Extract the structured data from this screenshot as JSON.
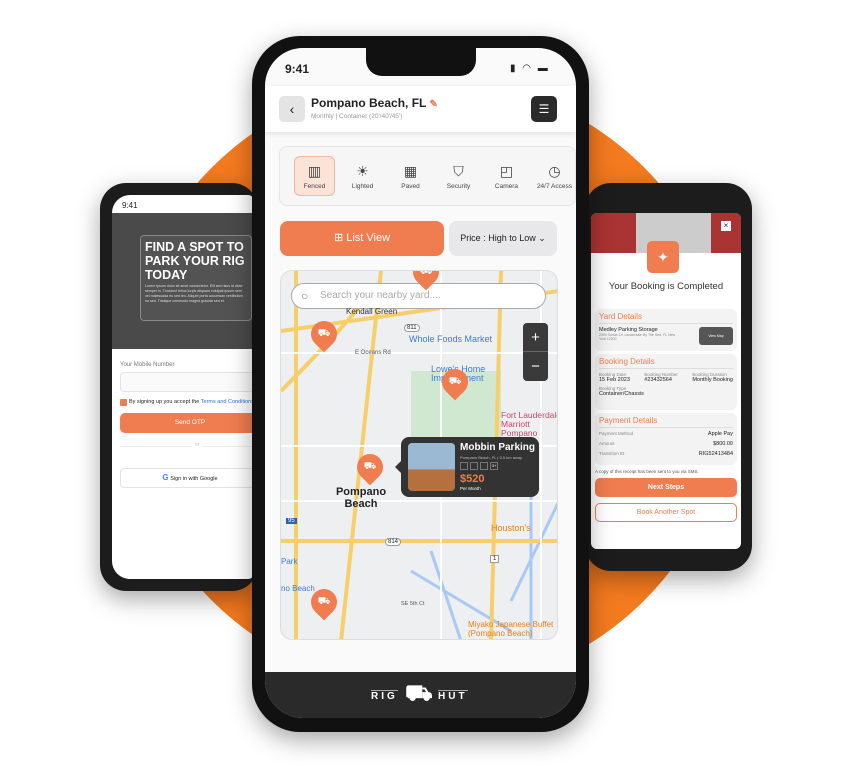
{
  "colors": {
    "accent": "#ef7d4f",
    "background_circle": "#f47a1f"
  },
  "main": {
    "status_time": "9:41",
    "header": {
      "title": "Pompano Beach, FL",
      "subtitle": "Monthly | Container (20'/40'/45')"
    },
    "amenities": [
      {
        "label": "Fenced",
        "icon": "fence-icon",
        "selected": true
      },
      {
        "label": "Lighted",
        "icon": "lightbulb-icon"
      },
      {
        "label": "Paved",
        "icon": "paved-icon"
      },
      {
        "label": "Security",
        "icon": "shield-check-icon"
      },
      {
        "label": "Camera",
        "icon": "cctv-camera-icon"
      },
      {
        "label": "24/7 Access",
        "icon": "clock-24-icon"
      }
    ],
    "list_view_label": "List View",
    "sort": {
      "selected": "Price : High to Low"
    },
    "search": {
      "placeholder": "Search your nearby yard...."
    },
    "zoom_in": "+",
    "zoom_out": "−",
    "map_labels": {
      "kendall": "Kendall Green",
      "whole_foods": "Whole Foods Market",
      "lowes": "Lowe's Home Improvement",
      "oceans": "E Oceans Rd",
      "marriott": "Fort Lauderdale Marriott Pompano",
      "city": "Pompano Beach",
      "houstons": "Houston's",
      "park": "Park",
      "beach": "no Beach",
      "miyako": "Miyako Japanese Buffet (Pompano Beach)",
      "se5": "SE 5th Ct",
      "r811": "811",
      "r814": "814",
      "r1": "1",
      "i95": "95"
    },
    "popup": {
      "title": "Mobbin Parking",
      "location": "Pompano Beach, FL | 0.5 km away",
      "price": "$520",
      "period": "Per Month",
      "more": "3+"
    },
    "brand": {
      "left": "RIG",
      "right": "HUT"
    }
  },
  "left": {
    "status_time": "9:41",
    "hero_title": "FIND A SPOT TO PARK YOUR RIG TODAY",
    "hero_body": "Lorem ipsum dolor sit amet consectetur. Elit sed risus id vitae semper in. Tincidunt tellus turpis aliquam volutpat ipsum sem vel malesuada eu sed leo. Aliquet porta accumsan vestibulum eu sed. Tristique commodo magna gravida sed et.",
    "mobile_label": "Your Mobile Number",
    "terms_prefix": "By signing up you accept the ",
    "terms_link": "Terms and Conditions",
    "send_otp": "Send OTP",
    "or": "or",
    "google": "Sign in with Google"
  },
  "right": {
    "close": "×",
    "title": "Your Booking is Completed",
    "yard": {
      "heading": "Yard Details",
      "name": "Medley Parking Storage",
      "address": "2390 Ocean Dr, Lauderdale By The Sea, FL New York 12000",
      "action": "View Map"
    },
    "booking": {
      "heading": "Booking Details",
      "fields": [
        {
          "label": "Booking Date",
          "value": "15 Feb 2023"
        },
        {
          "label": "Booking Number",
          "value": "#23432564"
        },
        {
          "label": "Booking Duration",
          "value": "Monthly Booking"
        },
        {
          "label": "Booking Type",
          "value": "Container/Chassis"
        }
      ]
    },
    "payment": {
      "heading": "Payment Details",
      "rows": [
        {
          "label": "Payment Method",
          "value": "Apple Pay"
        },
        {
          "label": "Amount",
          "value": "$800.00"
        },
        {
          "label": "Transition ID",
          "value": "RIG52413484"
        }
      ]
    },
    "note": "A copy of this receipt has been sent to you via SMS.",
    "next": "Next Steps",
    "book_another": "Book Another Spot"
  }
}
